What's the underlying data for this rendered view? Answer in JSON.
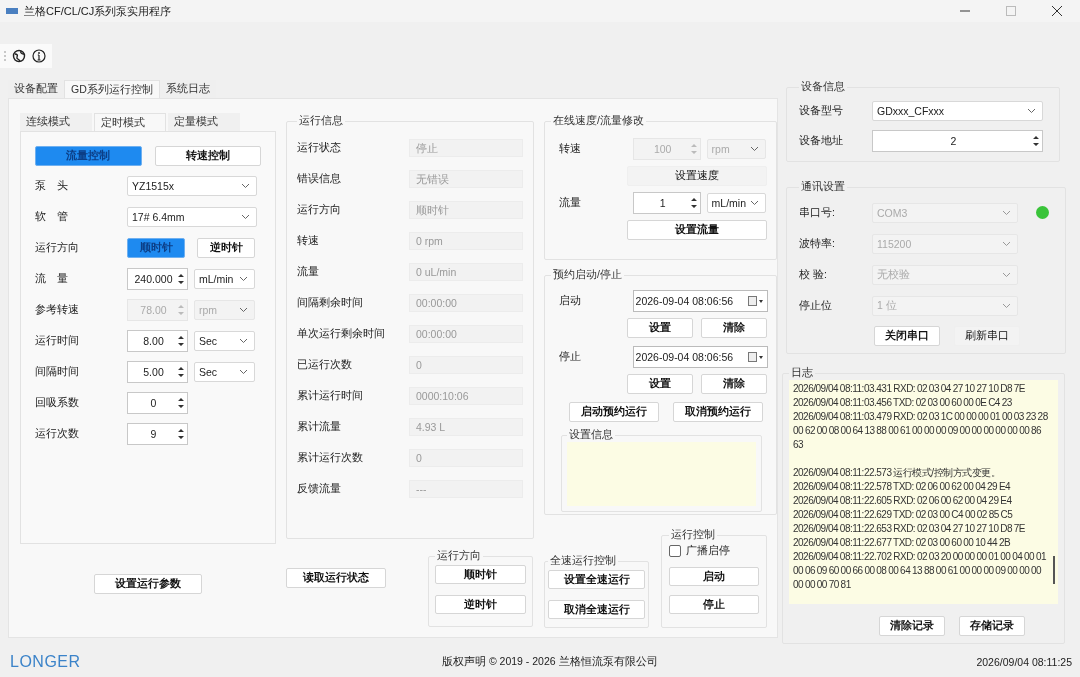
{
  "window": {
    "title": "兰格CF/CL/CJ系列泵实用程序"
  },
  "tabs": [
    {
      "label": "设备配置",
      "selected": false
    },
    {
      "label": "GD系列运行控制",
      "selected": true
    },
    {
      "label": "系统日志",
      "selected": false
    }
  ],
  "mode_tabs": [
    {
      "label": "连续模式",
      "selected": false
    },
    {
      "label": "定时模式",
      "selected": true
    },
    {
      "label": "定量模式",
      "selected": false
    }
  ],
  "control_mode": [
    {
      "label": "流量控制",
      "selected": true
    },
    {
      "label": "转速控制",
      "selected": false
    }
  ],
  "params": [
    {
      "kind": "select",
      "label": "泵　头",
      "value": "YZ1515x",
      "disabled": false
    },
    {
      "kind": "select",
      "label": "软　管",
      "value": "17# 6.4mm",
      "disabled": false
    },
    {
      "kind": "toggle",
      "label": "运行方向",
      "options": [
        {
          "label": "顺时针",
          "selected": true
        },
        {
          "label": "逆时针",
          "selected": false
        }
      ]
    },
    {
      "kind": "spin",
      "label": "流　量",
      "value": "240.000",
      "unit": "mL/min",
      "disabled": false
    },
    {
      "kind": "spin",
      "label": "参考转速",
      "value": "78.00",
      "unit": "rpm",
      "disabled": true
    },
    {
      "kind": "spin",
      "label": "运行时间",
      "value": "8.00",
      "unit": "Sec",
      "disabled": false
    },
    {
      "kind": "spin",
      "label": "间隔时间",
      "value": "5.00",
      "unit": "Sec",
      "disabled": false
    },
    {
      "kind": "spin",
      "label": "回吸系数",
      "value": "0",
      "disabled": false
    },
    {
      "kind": "spin",
      "label": "运行次数",
      "value": "9",
      "disabled": false
    }
  ],
  "set_params_button": "设置运行参数",
  "run_info": {
    "title": "运行信息",
    "rows": [
      {
        "label": "运行状态",
        "value": "停止"
      },
      {
        "label": "错误信息",
        "value": "无错误"
      },
      {
        "label": "运行方向",
        "value": "顺时针"
      },
      {
        "label": "转速",
        "value": "0 rpm"
      },
      {
        "label": "流量",
        "value": "0 uL/min"
      },
      {
        "label": "间隔剩余时间",
        "value": "00:00:00"
      },
      {
        "label": "单次运行剩余时间",
        "value": "00:00:00"
      },
      {
        "label": "已运行次数",
        "value": "0"
      },
      {
        "label": "累计运行时间",
        "value": "0000:10:06"
      },
      {
        "label": "累计流量",
        "value": "4.93 L"
      },
      {
        "label": "累计运行次数",
        "value": "0"
      },
      {
        "label": "反馈流量",
        "value": "---"
      }
    ]
  },
  "read_status_button": "读取运行状态",
  "direction": {
    "title": "运行方向",
    "buttons": [
      "顺时针",
      "逆时针"
    ]
  },
  "online": {
    "title": "在线速度/流量修改",
    "rows": [
      {
        "label": "转速",
        "value": "100",
        "unit": "rpm",
        "disabled": true,
        "button": "设置速度"
      },
      {
        "label": "流量",
        "value": "1",
        "unit": "mL/min",
        "disabled": false,
        "button": "设置流量"
      }
    ]
  },
  "schedule": {
    "title": "预约启动/停止",
    "rows": [
      {
        "label": "启动",
        "value": "2026-09-04 08:06:56",
        "buttons": [
          "设置",
          "清除"
        ]
      },
      {
        "label": "停止",
        "value": "2026-09-04 08:06:56",
        "buttons": [
          "设置",
          "清除"
        ]
      }
    ],
    "buttons": [
      "启动预约运行",
      "取消预约运行"
    ],
    "info_title": "设置信息"
  },
  "full_speed": {
    "title": "全速运行控制",
    "buttons": [
      "设置全速运行",
      "取消全速运行"
    ]
  },
  "run_control": {
    "title": "运行控制",
    "broadcast": {
      "label": "广播启停",
      "checked": false
    },
    "buttons": [
      "启动",
      "停止"
    ]
  },
  "device_info": {
    "title": "设备信息",
    "model": {
      "label": "设备型号",
      "value": "GDxxx_CFxxx"
    },
    "address": {
      "label": "设备地址",
      "value": "2"
    }
  },
  "comm": {
    "title": "通讯设置",
    "connected": true,
    "fields": [
      {
        "label": "串口号:",
        "value": "COM3",
        "disabled": true
      },
      {
        "label": "波特率:",
        "value": "115200",
        "disabled": true
      },
      {
        "label": "校  验:",
        "value": "无校验",
        "disabled": true
      },
      {
        "label": "停止位",
        "value": "1 位",
        "disabled": true
      }
    ],
    "buttons": [
      "关闭串口",
      "刷新串口"
    ]
  },
  "log": {
    "title": "日志",
    "blocks": [
      [
        "2026/09/04 08:11:03.431 RXD: 02 03 04 27 10 27 10 D8 7E",
        "2026/09/04 08:11:03.456 TXD: 02 03 00 60 00 0E C4 23",
        "2026/09/04 08:11:03.479 RXD: 02 03 1C 00 00 00 01 00 03 23 28 00 62 00 08 00 64 13 88 00 61 00 00 00 09 00 00 00 00 00 00 86 63"
      ],
      [
        "2026/09/04 08:11:22.573 运行模式/控制方式变更。",
        "2026/09/04 08:11:22.578 TXD: 02 06 00 62 00 04 29 E4",
        "2026/09/04 08:11:22.605 RXD: 02 06 00 62 00 04 29 E4",
        "2026/09/04 08:11:22.629 TXD: 02 03 00 C4 00 02 85 C5",
        "2026/09/04 08:11:22.653 RXD: 02 03 04 27 10 27 10 D8 7E",
        "2026/09/04 08:11:22.677 TXD: 02 03 00 60 00 10 44 2B",
        "2026/09/04 08:11:22.702 RXD: 02 03 20 00 00 00 01 00 04 00 01 00 06 09 60 00 66 00 08 00 64 13 88 00 61 00 00 00 09 00 00 00 00 00 00 70 81"
      ]
    ],
    "buttons": [
      "清除记录",
      "存储记录"
    ]
  },
  "footer": {
    "logo": "LONGER",
    "copyright": "版权声明 © 2019 - 2026 兰格恒流泵有限公司",
    "time": "2026/09/04 08:11:25"
  }
}
